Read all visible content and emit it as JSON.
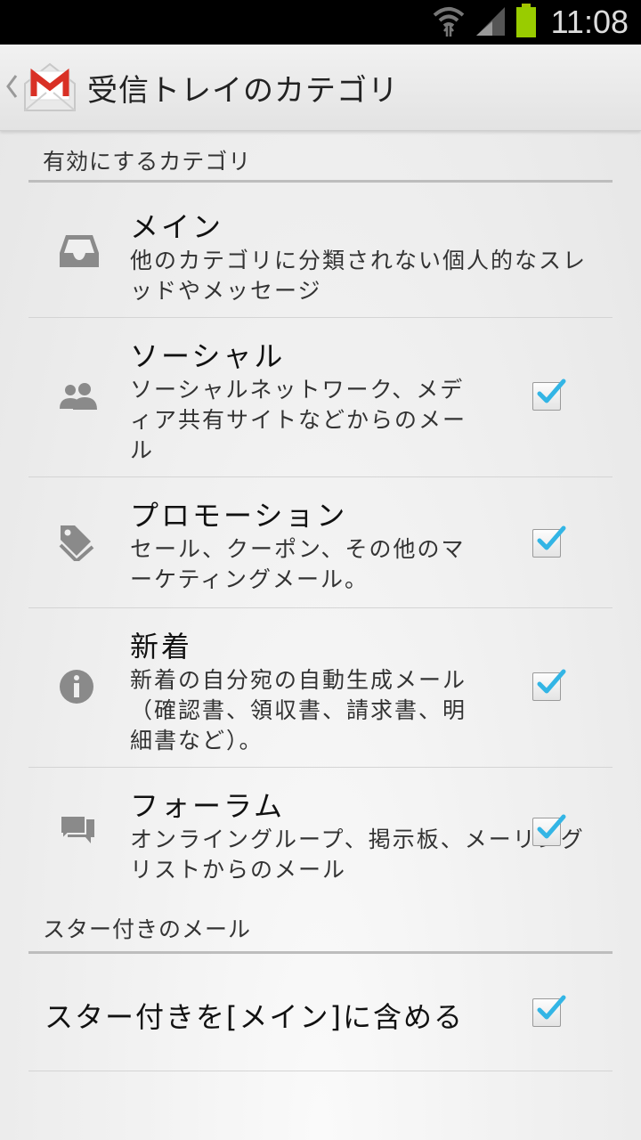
{
  "status_bar": {
    "time": "11:08"
  },
  "action_bar": {
    "title": "受信トレイのカテゴリ",
    "logo_icon": "gmail-envelope-icon"
  },
  "section_enabled": {
    "label": "有効にするカテゴリ"
  },
  "categories": [
    {
      "title": "メイン",
      "description": "他のカテゴリに分類されない個人的なスレッドやメッセージ",
      "icon": "inbox-tray-icon",
      "checked": false
    },
    {
      "title": "ソーシャル",
      "description": "ソーシャルネットワーク、メディア共有サイトなどからのメール",
      "icon": "people-icon",
      "checked": true
    },
    {
      "title": "プロモーション",
      "description": "セール、クーポン、その他のマーケティングメール。",
      "icon": "tag-icon",
      "checked": true
    },
    {
      "title": "新着",
      "description": "新着の自分宛の自動生成メール（確認書、領収書、請求書、明細書など）。",
      "icon": "info-icon",
      "checked": true
    },
    {
      "title": "フォーラム",
      "description": "オンライングループ、掲示板、メーリングリストからのメール",
      "icon": "forum-chat-icon",
      "checked": true
    }
  ],
  "section_starred": {
    "label": "スター付きのメール"
  },
  "starred_option": {
    "label": "スター付きを[メイン]に含める",
    "checked": true
  },
  "colors": {
    "checkmark": "#33b5e5",
    "icon_gray": "#8a8a8a",
    "gmail_red": "#d93025"
  }
}
